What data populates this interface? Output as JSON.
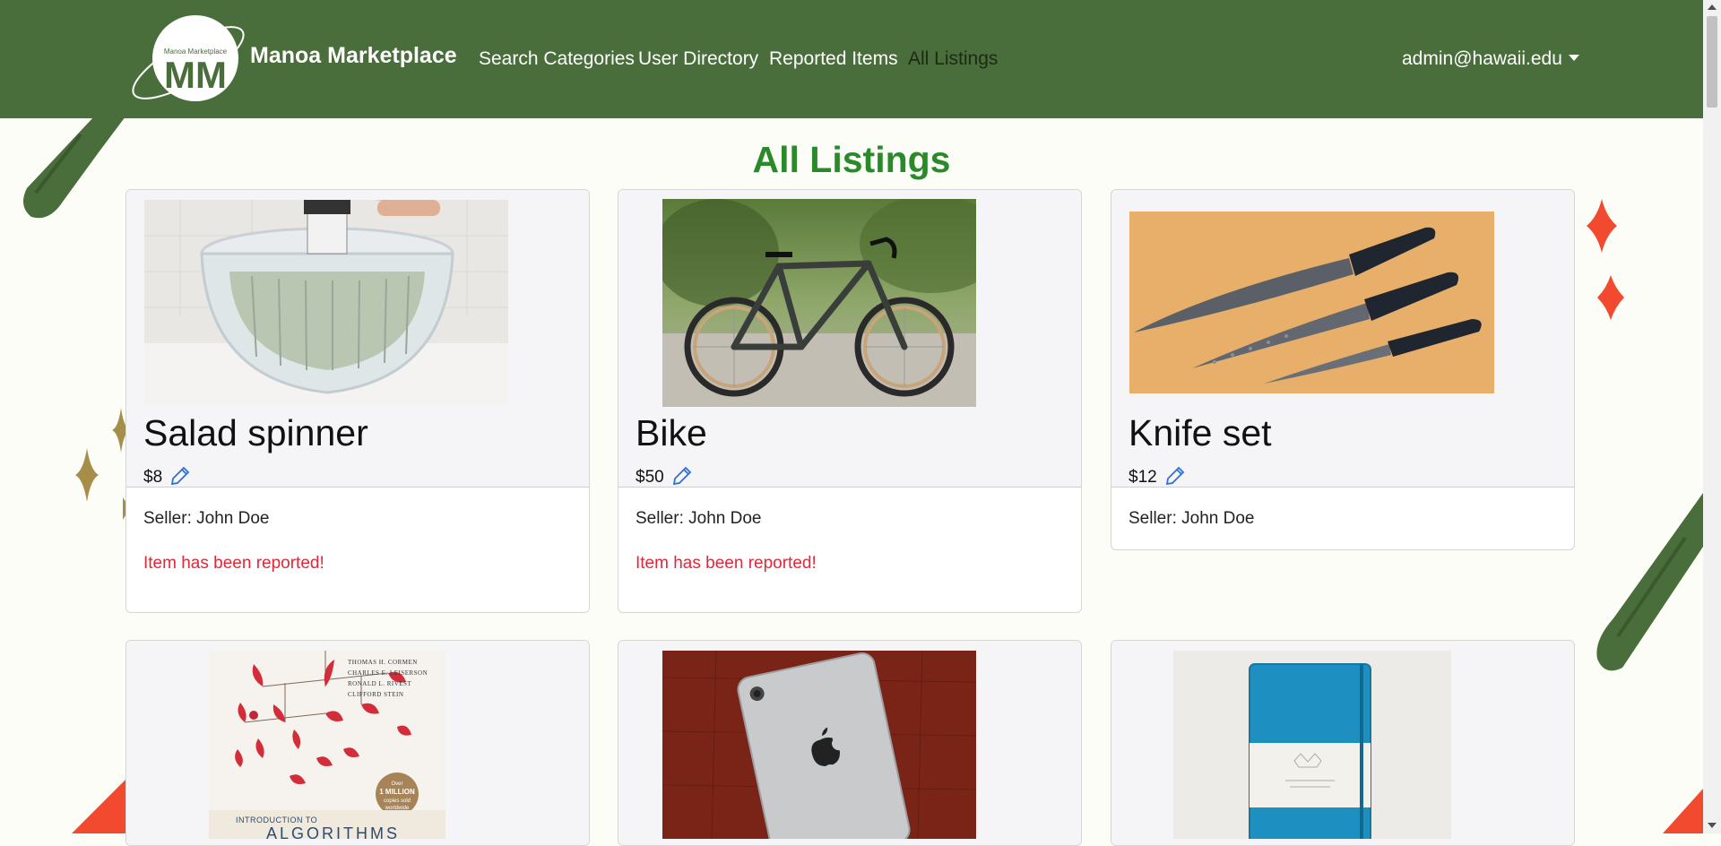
{
  "nav": {
    "logo_text": "Manoa Marketplace",
    "brand": "Manoa Marketplace",
    "links": [
      "Search Categories",
      "User Directory",
      "Reported Items",
      "All Listings"
    ],
    "active": "All Listings",
    "user": "admin@hawaii.edu"
  },
  "page": {
    "title": "All Listings"
  },
  "listings": [
    {
      "name": "Salad spinner",
      "price": "$8",
      "seller": "Seller: John Doe",
      "reported": "Item has been reported!"
    },
    {
      "name": "Bike",
      "price": "$50",
      "seller": "Seller: John Doe",
      "reported": "Item has been reported!"
    },
    {
      "name": "Knife set",
      "price": "$12",
      "seller": "Seller: John Doe",
      "reported": ""
    },
    {
      "name": "Introduction to Algorithms",
      "book_authors": [
        "THOMAS H. CORMEN",
        "CHARLES E. LEISERSON",
        "RONALD L. RIVEST",
        "CLIFFORD STEIN"
      ],
      "book_badge": [
        "Over",
        "1 MILLION",
        "copies sold",
        "worldwide"
      ],
      "book_title_1": "INTRODUCTION TO",
      "book_title_2": "ALGORITHMS"
    },
    {
      "name": "iPad"
    },
    {
      "name": "Notebook"
    }
  ],
  "colors": {
    "navbar": "#4a6d3c",
    "title": "#2a8a2a",
    "reported": "#e0283a",
    "edit_icon": "#2f6fd8"
  },
  "icons": [
    "pencil-icon",
    "caret-down-icon"
  ]
}
